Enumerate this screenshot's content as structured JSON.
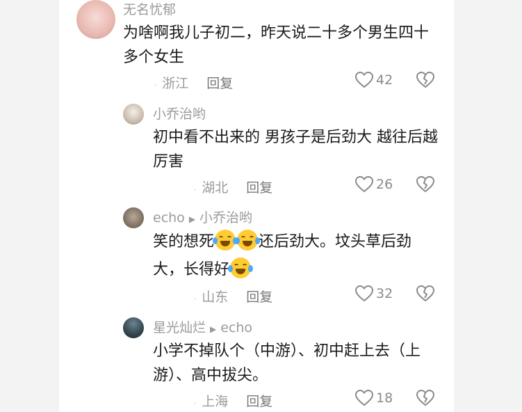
{
  "comments": [
    {
      "username": "无名忧郁",
      "text": "为啥啊我儿子初二，昨天说二十多个男生四十多个女生",
      "location": "浙江",
      "reply_label": "回复",
      "likes": "42",
      "avatar_color": "#f2c9c4"
    },
    {
      "username": "小乔治哟",
      "text": "初中看不出来的 男孩子是后劲大 越往后越厉害",
      "location": "湖北",
      "reply_label": "回复",
      "likes": "26",
      "avatar_color": "#d9cfc4"
    },
    {
      "username": "echo",
      "reply_to": "小乔治哟",
      "text_part1": "笑的想死",
      "text_part2": "还后劲大。坟头草后劲大，长得好",
      "location": "山东",
      "reply_label": "回复",
      "likes": "32",
      "avatar_color": "#8c7a6a"
    },
    {
      "username": "星光灿烂",
      "reply_to": "echo",
      "text": "小学不掉队个（中游）、初中赶上去（上游）、高中拔尖。",
      "location": "上海",
      "reply_label": "回复",
      "likes": "18",
      "avatar_color": "#3a4a52"
    }
  ],
  "icons": {
    "like": "heart-outline-icon",
    "dislike": "broken-heart-icon",
    "emoji": "tears-of-joy-emoji",
    "reply_arrow": "right-triangle-icon"
  }
}
